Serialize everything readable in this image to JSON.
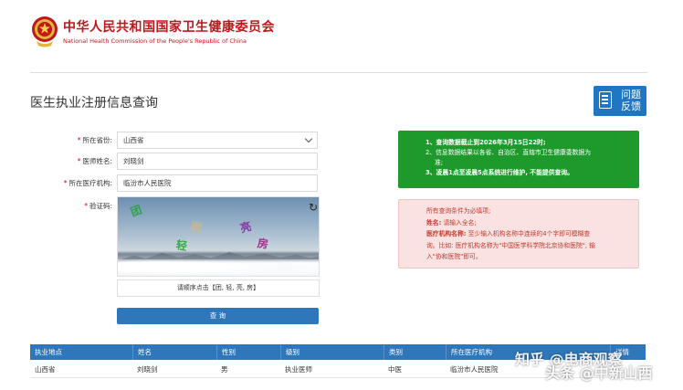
{
  "header": {
    "org_name_cn": "中华人民共和国国家卫生健康委员会",
    "org_name_en": "National Health Commission of the People's Republic of China",
    "emblem_icon": "national-emblem-icon"
  },
  "page": {
    "title": "医生执业注册信息查询",
    "feedback_label": "问题反馈"
  },
  "form": {
    "province": {
      "label": "所在省份:",
      "value": "山西省"
    },
    "doctor_name": {
      "label": "医师姓名:",
      "value": "刘晓剑"
    },
    "institution": {
      "label": "所在医疗机构:",
      "value": "临汾市人民医院"
    },
    "captcha": {
      "label": "验证码:",
      "chars": [
        "团",
        "轻",
        "亮",
        "房",
        "网"
      ],
      "hint": "请顺序点击【团, 轻, 亮, 房】",
      "refresh_icon": "refresh-icon"
    },
    "required_mark": "*",
    "query_button": "查 询"
  },
  "notice_green": {
    "line1": "1、查询数据截止到2026年3月15日22时;",
    "line2": "2、信息数据结果以各省、自治区、直辖市卫生健康委数据为",
    "line2b": "准;",
    "line3": "3、凌晨1点至凌晨5点系统进行维护, 不能提供查询。"
  },
  "notice_red": {
    "line1": "所有查询条件为必填项;",
    "line2_bold": "姓名:",
    "line2": "请输入全名;",
    "line3_bold": "医疗机构名称:",
    "line3": "至少输入机构名称中连续的4个字即可模糊查",
    "line4": "询。比如: 医疗机构名称为\"中国医学科学院北京协和医院\", 输",
    "line5": "入\"协和医院\"即可。"
  },
  "table": {
    "headers": [
      "执业地点",
      "姓名",
      "性别",
      "级别",
      "类别",
      "所在医疗机构",
      "详情"
    ],
    "rows": [
      [
        "山西省",
        "刘晓剑",
        "男",
        "执业医师",
        "中医",
        "临汾市人民医院"
      ]
    ]
  },
  "watermark": {
    "line1": "知乎 @电商观察",
    "line2": "头条 @中新山西"
  },
  "colors": {
    "brand_red": "#c0161c",
    "primary_blue": "#2f77bb",
    "notice_green": "#1e9a2c",
    "notice_red_bg": "#fbe2e2"
  }
}
